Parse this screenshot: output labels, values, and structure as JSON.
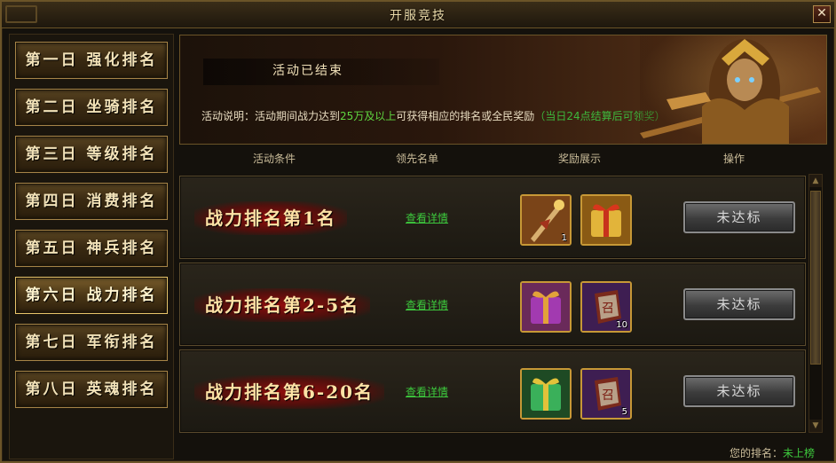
{
  "window": {
    "title": "开服竞技",
    "close_label": "✕"
  },
  "sidebar": {
    "items": [
      {
        "label": "第一日 强化排名"
      },
      {
        "label": "第二日 坐骑排名"
      },
      {
        "label": "第三日 等级排名"
      },
      {
        "label": "第四日 消费排名"
      },
      {
        "label": "第五日 神兵排名"
      },
      {
        "label": "第六日 战力排名",
        "active": true
      },
      {
        "label": "第七日 军衔排名"
      },
      {
        "label": "第八日 英魂排名"
      }
    ]
  },
  "banner": {
    "status": "活动已结束",
    "desc_prefix": "活动说明：活动期间战力达到",
    "desc_highlight": "25万及以上",
    "desc_middle": "可获得相应的排名或全民奖励",
    "desc_note": "（当日24点结算后可领奖）"
  },
  "columns": {
    "condition": "活动条件",
    "leaders": "领先名单",
    "rewards": "奖励展示",
    "action": "操作"
  },
  "rows": [
    {
      "rank": "战力排名第1名",
      "detail": "查看详情",
      "rewards": [
        {
          "icon": "weapon-staff-icon",
          "qty": "1"
        },
        {
          "icon": "gift-box-gold-icon",
          "qty": ""
        }
      ],
      "action": "未达标"
    },
    {
      "rank": "战力排名第2-5名",
      "detail": "查看详情",
      "rewards": [
        {
          "icon": "gift-box-purple-icon",
          "qty": ""
        },
        {
          "icon": "summon-token-icon",
          "qty": "10"
        }
      ],
      "action": "未达标"
    },
    {
      "rank": "战力排名第6-20名",
      "detail": "查看详情",
      "rewards": [
        {
          "icon": "gift-box-green-icon",
          "qty": ""
        },
        {
          "icon": "summon-token-icon",
          "qty": "5"
        }
      ],
      "action": "未达标"
    }
  ],
  "footer": {
    "my_rank_label": "您的排名：",
    "my_rank_value": "未上榜"
  },
  "colors": {
    "accent_gold": "#c79836",
    "highlight_green": "#3dc93d",
    "rank_red": "#8a0a0a"
  }
}
